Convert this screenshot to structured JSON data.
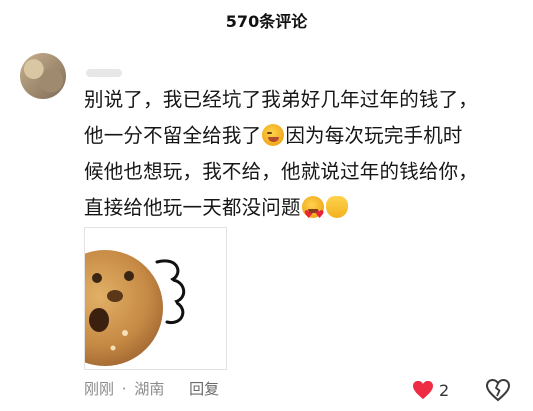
{
  "header": {
    "title": "570条评论"
  },
  "comment": {
    "lines": [
      {
        "a": "别说了，我已经坑了我弟好几年过年的钱了，",
        "emoji": null,
        "b": ""
      },
      {
        "a": "他一分不留全给我了",
        "emoji": "wink",
        "b": "因为每次玩完手机时"
      },
      {
        "a": "候他也想玩，我不给，他就说过年的钱给你，",
        "emoji": null,
        "b": ""
      },
      {
        "a": "直接给他玩一天都没问题",
        "emoji": "heart-eyes + hand",
        "b": ""
      }
    ],
    "meta": {
      "time": "刚刚",
      "dot": "·",
      "location": "湖南",
      "reply": "回复"
    },
    "likes": {
      "count": "2"
    }
  },
  "colors": {
    "like_red": "#ee2c44",
    "meta_gray": "#8b8b8b"
  }
}
